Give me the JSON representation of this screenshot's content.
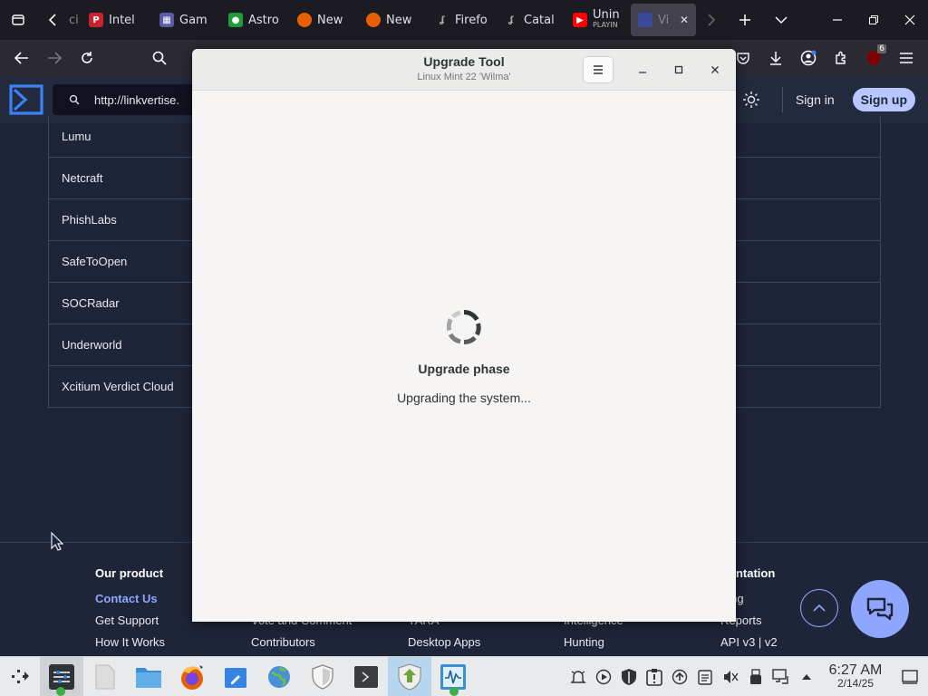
{
  "browser": {
    "tabs": [
      {
        "label": "Intel",
        "icon": "pinterest-like-icon",
        "color": "#c8232c"
      },
      {
        "label": "Gam",
        "icon": "site-icon",
        "color": "#5a5aa8"
      },
      {
        "label": "Astro",
        "icon": "green-app-icon",
        "color": "#1f9b3a"
      },
      {
        "label": "New",
        "icon": "firefox-icon",
        "color": "#e66000"
      },
      {
        "label": "New",
        "icon": "firefox-icon",
        "color": "#e66000"
      },
      {
        "label": "Firefo",
        "icon": "leaf-icon",
        "color": "#777"
      },
      {
        "label": "Catal",
        "icon": "leaf-icon",
        "color": "#777"
      },
      {
        "label": "Unin",
        "sub": "PLAYIN",
        "icon": "youtube-icon",
        "color": "#ff0000"
      },
      {
        "label": "Vi",
        "icon": "virustotal-icon",
        "color": "#3a4a9a",
        "active": true
      }
    ],
    "url_partial": "http://linkvertise.",
    "badge_count": "6"
  },
  "site": {
    "sign_in": "Sign in",
    "sign_up": "Sign up",
    "vendors": [
      "Lumu",
      "Netcraft",
      "PhishLabs",
      "SafeToOpen",
      "SOCRadar",
      "Underworld",
      "Xcitium Verdict Cloud"
    ],
    "footer": {
      "col1": {
        "heading": "Our product",
        "items": [
          "Contact Us",
          "Get Support",
          "How It Works"
        ]
      },
      "col2": {
        "items": [
          "Vote and Comment",
          "Contributors"
        ]
      },
      "col3": {
        "items": [
          "YARA",
          "Desktop Apps"
        ]
      },
      "col4": {
        "items": [
          "Intelligence",
          "Hunting"
        ]
      },
      "col5": {
        "heading": "cumentation",
        "items": [
          "arching",
          "Reports",
          "API v3 | v2"
        ]
      }
    }
  },
  "dialog": {
    "title": "Upgrade Tool",
    "subtitle": "Linux Mint 22 'Wilma'",
    "phase": "Upgrade phase",
    "status": "Upgrading the system..."
  },
  "taskbar": {
    "time": "6:27 AM",
    "date": "2/14/25"
  },
  "colors": {
    "accent": "#3b82f6",
    "signup_bg": "#b8c7ff",
    "chat_fab": "#8ea6ff"
  }
}
